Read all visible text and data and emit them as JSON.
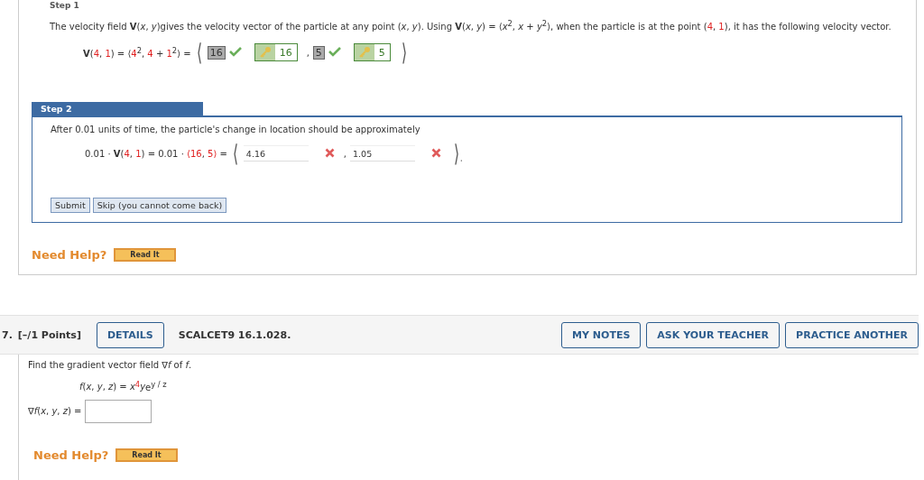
{
  "step1": {
    "label": "Step 1",
    "intro": [
      {
        "text": "The velocity field **V**(*x*, *y*)gives the velocity vector of the particle at any point (*x*, *y*). Using **V**(*x*, *y*) = ⟨*x*$^{2}$, *x* + *y*$^{2}$⟩, when the particle is at the point (",
        "highlight": false
      },
      {
        "text": "4",
        "highlight": true
      },
      {
        "text": ", ",
        "highlight": false
      },
      {
        "text": "1",
        "highlight": true
      },
      {
        "text": "), it has the following velocity vector.",
        "highlight": false
      }
    ],
    "formula": [
      {
        "text": "**V**(",
        "highlight": false
      },
      {
        "text": "4",
        "highlight": true
      },
      {
        "text": ", ",
        "highlight": false
      },
      {
        "text": "1",
        "highlight": true
      },
      {
        "text": ") = ⟨",
        "highlight": false
      },
      {
        "text": "4",
        "highlight": true
      },
      {
        "text": "$^{2}$, ",
        "highlight": false
      },
      {
        "text": "4",
        "highlight": true
      },
      {
        "text": " + ",
        "highlight": false
      },
      {
        "text": "1",
        "highlight": true
      },
      {
        "text": "$^{2}$⟩ =",
        "highlight": false
      }
    ],
    "open": "⟨",
    "close": "⟩",
    "separator": ",",
    "answers": [
      {
        "value": "16",
        "correct": true,
        "key": "16"
      },
      {
        "value": "5",
        "correct": true,
        "key": "5"
      }
    ]
  },
  "step2": {
    "label": "Step 2",
    "prompt": "After 0.01 units of time, the particle's change in location should be approximately",
    "formula": [
      {
        "text": "0.01 · **V**(",
        "highlight": false
      },
      {
        "text": "4",
        "highlight": true
      },
      {
        "text": ", ",
        "highlight": false
      },
      {
        "text": "1",
        "highlight": true
      },
      {
        "text": ") = 0.01 · ",
        "highlight": false
      },
      {
        "text": "⟨16",
        "highlight": true
      },
      {
        "text": ", ",
        "highlight": false
      },
      {
        "text": "5⟩",
        "highlight": true
      },
      {
        "text": " =",
        "highlight": false
      }
    ],
    "open": "⟨",
    "close": "⟩.",
    "separator": ",",
    "answers": [
      {
        "value": "4.16",
        "correct": false
      },
      {
        "value": "1.05",
        "correct": false
      }
    ],
    "buttons": [
      "Submit",
      "Skip (you cannot come back)"
    ]
  },
  "help1": {
    "label": "Need Help?",
    "button": "Read It"
  },
  "question": {
    "number": "7.",
    "points": "[–/1 Points]",
    "details": "DETAILS",
    "code": "SCALCET9 16.1.028.",
    "actions": [
      "MY NOTES",
      "ASK YOUR TEACHER",
      "PRACTICE ANOTHER"
    ],
    "prompt": "Find the gradient vector field ∇*f* of *f*.",
    "function": [
      {
        "text": "*f*(*x*, *y*, *z*) = *x*",
        "highlight": false
      },
      {
        "text": "$^{4}$",
        "highlight": true
      },
      {
        "text": "*y*",
        "highlight": false
      },
      {
        "text": "e$^{y / z}$",
        "highlight": false
      }
    ],
    "answer_label": "∇*f*(*x*, *y*, *z*) ="
  },
  "help2": {
    "label": "Need Help?",
    "button": "Read It"
  }
}
